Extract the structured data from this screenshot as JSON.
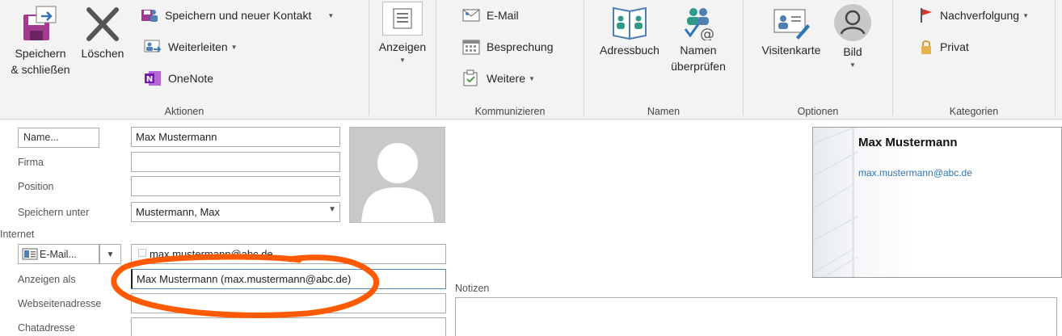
{
  "ribbon": {
    "aktionen": {
      "label": "Aktionen",
      "save_close": "Speichern\n& schließen",
      "delete": "Löschen",
      "save_new": "Speichern und neuer Kontakt",
      "forward": "Weiterleiten",
      "onenote": "OneNote"
    },
    "anzeigen": {
      "label": "Anzeigen"
    },
    "kommunizieren": {
      "label": "Kommunizieren",
      "email": "E-Mail",
      "meeting": "Besprechung",
      "more": "Weitere"
    },
    "namen": {
      "label": "Namen",
      "addressbook": "Adressbuch",
      "check_names": "Namen\nüberprüfen"
    },
    "optionen": {
      "label": "Optionen",
      "business_card": "Visitenkarte",
      "picture": "Bild"
    },
    "kategorien": {
      "label": "Kategorien",
      "followup": "Nachverfolgung",
      "private": "Privat"
    }
  },
  "form": {
    "name_button": "Name...",
    "name_value": "Max Mustermann",
    "company_label": "Firma",
    "company_value": "",
    "position_label": "Position",
    "position_value": "",
    "file_as_label": "Speichern unter",
    "file_as_value": "Mustermann, Max",
    "internet_label": "Internet",
    "email_button": "E-Mail...",
    "email_value": "max.mustermann@abc.de",
    "display_as_label": "Anzeigen als",
    "display_as_value": "Max Mustermann (max.mustermann@abc.de)",
    "web_label": "Webseitenadresse",
    "web_value": "",
    "im_label": "Chatadresse",
    "im_value": "",
    "notes_label": "Notizen"
  },
  "business_card": {
    "name": "Max Mustermann",
    "email": "max.mustermann@abc.de"
  },
  "colors": {
    "ribbon_bg": "#f3f3f3",
    "annotation": "#ff5a00",
    "link": "#2e75b6",
    "onenote": "#7719aa"
  }
}
